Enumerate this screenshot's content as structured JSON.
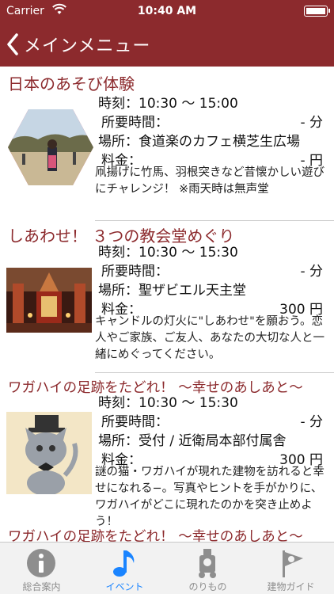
{
  "status_bar": {
    "carrier": "Carrier",
    "time": "10:40 AM"
  },
  "nav": {
    "back_label": "メインメニュー"
  },
  "events": [
    {
      "title": "日本のあそび体験",
      "time_label": "時刻：",
      "time_value": "10:30 ～ 15:00",
      "duration_label": "所要時間：",
      "duration_value": "- 分",
      "place_label": "場所：",
      "place_value": "食道楽のカフェ横芝生広場",
      "fee_label": "料金：",
      "fee_value": "- 円",
      "description": "凧揚げに竹馬、羽根突きなど昔懐かしい遊びにチャレンジ！ ※雨天時は無声堂"
    },
    {
      "title": "しあわせ！ ３つの教会堂めぐり",
      "time_label": "時刻：",
      "time_value": "10:30 ～ 15:30",
      "duration_label": "所要時間：",
      "duration_value": "- 分",
      "place_label": "場所：",
      "place_value": "聖ザビエル天主堂",
      "fee_label": "料金：",
      "fee_value": "300 円",
      "description": "キャンドルの灯火に\"しあわせ\"を願おう。恋人やご家族、ご友人、あなたの大切な人と一緒にめぐってください。"
    },
    {
      "title": "ワガハイの足跡をたどれ！ ～幸せのあしあと～",
      "time_label": "時刻：",
      "time_value": "10:30 ～ 15:30",
      "duration_label": "所要時間：",
      "duration_value": "- 分",
      "place_label": "場所：",
      "place_value": "受付 / 近衛局本部付属舎",
      "fee_label": "料金：",
      "fee_value": "300 円",
      "description": "謎の猫・ワガハイが現れた建物を訪れると幸せになれる−。写真やヒントを手がかりに、ワガハイがどこに現れたのかを突き止めよう！"
    },
    {
      "title": "ワガハイの足跡をたどれ！ ～幸せのあしあと～"
    }
  ],
  "tabs": [
    {
      "label": "総合案内",
      "icon": "info-icon"
    },
    {
      "label": "イベント",
      "icon": "music-note-icon"
    },
    {
      "label": "のりもの",
      "icon": "locomotive-icon"
    },
    {
      "label": "建物ガイド",
      "icon": "pennant-icon"
    }
  ],
  "colors": {
    "brand": "#8c2a2d",
    "tab_active": "#1a84ff",
    "tab_inactive": "#8e8e8e"
  }
}
